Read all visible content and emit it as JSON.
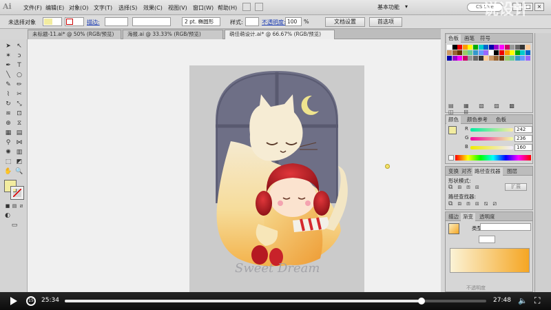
{
  "app": {
    "logo": "Ai"
  },
  "menu": [
    "文件(F)",
    "编辑(E)",
    "对象(O)",
    "文字(T)",
    "选择(S)",
    "效果(C)",
    "视图(V)",
    "窗口(W)",
    "帮助(H)"
  ],
  "workspace": "基本功能",
  "search": {
    "label": "CS Live"
  },
  "control": {
    "no_selection": "未选择对象",
    "stroke_label": "描边:",
    "brush": "2 pt. 椭圆形",
    "style_label": "样式:",
    "opacity_label": "不透明度:",
    "opacity_value": "100",
    "opacity_unit": "%",
    "doc_setup": "文档设置",
    "prefs": "首选项"
  },
  "tabs": [
    {
      "label": "未标题-11.ai* @ 50% (RGB/预览)"
    },
    {
      "label": "海报.ai @ 33.33% (RGB/预览)"
    },
    {
      "label": "萌佳萌设计.ai* @ 66.67% (RGB/预览)"
    }
  ],
  "artwork": {
    "caption": "Sweet Dream"
  },
  "swatches_panel": {
    "tabs": [
      "色板",
      "画笔",
      "符号"
    ]
  },
  "color_panel": {
    "tabs": [
      "颜色",
      "颜色参考",
      "色板"
    ],
    "r": "242",
    "g": "236",
    "b": "160",
    "labels": [
      "R",
      "G",
      "B"
    ]
  },
  "pathfinder": {
    "tabs": [
      "变换",
      "对齐",
      "路径查找器",
      "图层"
    ],
    "shape_modes": "形状模式:",
    "expand": "扩展",
    "pathfinders": "路径查找器:"
  },
  "gradient": {
    "tabs": [
      "描边",
      "渐变",
      "透明度"
    ],
    "type_label": "类型:",
    "footer": "不透明度"
  },
  "player": {
    "current": "25:34",
    "total": "27:48",
    "progress": 0.847,
    "watermark": "说设计"
  },
  "colors": {
    "fill": "#f2eca0",
    "accent": "#f5a623"
  }
}
